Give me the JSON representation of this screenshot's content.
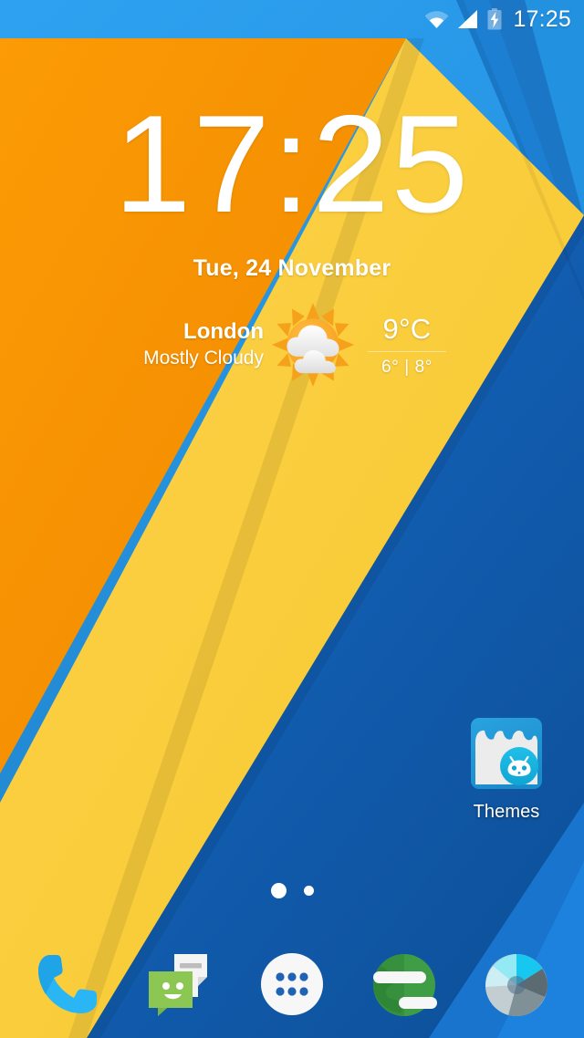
{
  "status_bar": {
    "clock": "17:25",
    "icons": [
      {
        "name": "wifi-icon",
        "label": "Wi-Fi signal full"
      },
      {
        "name": "cellular-signal-icon",
        "label": "Cellular signal full"
      },
      {
        "name": "battery-charging-icon",
        "label": "Battery charging"
      }
    ]
  },
  "clock_widget": {
    "time": "17:25",
    "date": "Tue, 24 November"
  },
  "weather_widget": {
    "city": "London",
    "condition": "Mostly Cloudy",
    "icon": "sun-behind-clouds-icon",
    "temperature": "9°C",
    "range": "6° | 8°",
    "low": "6°",
    "high": "8°"
  },
  "home_screen": {
    "icons": [
      {
        "name": "themes",
        "label": "Themes",
        "icon": "themes-icon"
      }
    ],
    "page_indicator": {
      "pages": 2,
      "current": 1
    }
  },
  "dock": {
    "items": [
      {
        "name": "phone",
        "label": "Phone",
        "icon": "phone-icon"
      },
      {
        "name": "messaging",
        "label": "Messaging",
        "icon": "messaging-icon"
      },
      {
        "name": "app-drawer",
        "label": "Apps",
        "icon": "app-drawer-icon"
      },
      {
        "name": "browser",
        "label": "Browser",
        "icon": "browser-globe-icon"
      },
      {
        "name": "camera",
        "label": "Camera",
        "icon": "camera-aperture-icon"
      }
    ]
  },
  "wallpaper": {
    "name": "material-diagonal-shards",
    "colors": {
      "blue_light": "#2196e8",
      "blue_light_2": "#2c9ef0",
      "blue_dark": "#1565c0",
      "blue_deep": "#0f59ad",
      "blue_band": "#1a7fd4",
      "orange": "#f59205",
      "orange_dark": "#f18a00",
      "yellow": "#fcd040",
      "yellow_dark": "#f7c933"
    }
  },
  "theme": {
    "accent": "#2196e8",
    "text_on_wallpaper": "#ffffff"
  }
}
